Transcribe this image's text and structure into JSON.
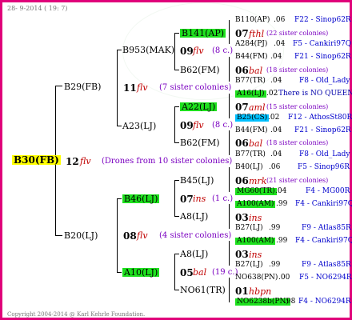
{
  "header": "28- 9-2014 ( 19: 7)",
  "footer": "Copyright 2004-2014 @ Karl Kehrle Foundation.",
  "root": {
    "name": "B30(FB)",
    "gen": "12",
    "bee": "flv",
    "note": "(Drones from 10 sister colonies)"
  },
  "gen1": [
    {
      "name": "B29(FB)",
      "gen": "11",
      "bee": "flv",
      "note": "(7 sister colonies)"
    },
    {
      "name": "B20(LJ)",
      "gen": "08",
      "bee": "flv",
      "note": "(4 sister colonies)"
    }
  ],
  "gen2": [
    {
      "name": "B953(MAK)",
      "gen": "09",
      "bee": "flv",
      "note": "(8 c.)"
    },
    {
      "name": "A23(LJ)",
      "gen": "09",
      "bee": "flv",
      "note": "(8 c.)"
    },
    {
      "name": "B46(LJ)",
      "gen": "07",
      "bee": "ins",
      "note": "(1 c.)"
    },
    {
      "name": "A10(LJ)",
      "gen": "05",
      "bee": "bal",
      "note": "(19 c.)"
    }
  ],
  "gen3": [
    {
      "name": "B141(AP)",
      "gen": "07",
      "bee": "fthl",
      "note": "(22 sister colonies)"
    },
    {
      "name": "B62(FM)",
      "gen": "06",
      "bee": "bal",
      "note": "(18 sister colonies)"
    },
    {
      "name": "A22(LJ)",
      "gen": "07",
      "bee": "aml",
      "note": "(15 sister colonies)"
    },
    {
      "name": "B62(FM)",
      "gen": "06",
      "bee": "bal",
      "note": "(18 sister colonies)"
    },
    {
      "name": "B45(LJ)",
      "gen": "06",
      "bee": "mrk",
      "note": "(21 sister colonies)"
    },
    {
      "name": "A8(LJ)",
      "gen": "03",
      "bee": "ins",
      "note": ""
    },
    {
      "name": "A8(LJ)",
      "gen": "03",
      "bee": "ins",
      "note": ""
    },
    {
      "name": "NO61(TR)",
      "gen": "01",
      "bee": "hbpn",
      "note": ""
    }
  ],
  "gen4": [
    {
      "name": "B110(AP)",
      "year": ".06",
      "src": "F22 - Sinop62R"
    },
    {
      "name": "A284(PJ)",
      "year": ".04",
      "src": "F5 - Cankiri97Q"
    },
    {
      "name": "B44(FM)",
      "year": ".04",
      "src": "F21 - Sinop62R"
    },
    {
      "name": "B77(TR)",
      "year": ".04",
      "src": "F8 - Old_Lady"
    },
    {
      "name": "A16(LJ)",
      "year": ".02",
      "src": "There is NO QUEEN"
    },
    {
      "name": "B25(CS)",
      "year": ".02",
      "src": "F12 - AthosSt80R"
    },
    {
      "name": "B44(FM)",
      "year": ".04",
      "src": "F21 - Sinop62R"
    },
    {
      "name": "B77(TR)",
      "year": ".04",
      "src": "F8 - Old_Lady"
    },
    {
      "name": "B40(LJ)",
      "year": ".06",
      "src": "F5 - Sinop96R"
    },
    {
      "name": "MG60(TR)",
      "year": ".04",
      "src": "F4 - MG00R"
    },
    {
      "name": "A100(AM)",
      "year": ".99",
      "src": "F4 - Cankiri97Q"
    },
    {
      "name": "B27(LJ)",
      "year": ".99",
      "src": "F9 - Atlas85R"
    },
    {
      "name": "A100(AM)",
      "year": ".99",
      "src": "F4 - Cankiri97Q"
    },
    {
      "name": "B27(LJ)",
      "year": ".99",
      "src": "F9 - Atlas85R"
    },
    {
      "name": "NO638(PN)",
      "year": ".00",
      "src": "F5 - NO6294R"
    },
    {
      "name": "NO6238b(PN)",
      "year": ".98",
      "src": "F4 - NO6294R"
    }
  ]
}
